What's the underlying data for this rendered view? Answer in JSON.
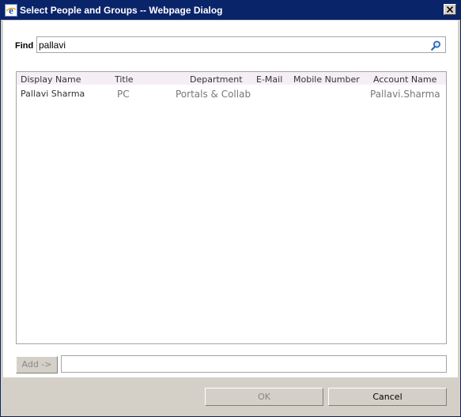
{
  "window": {
    "title": "Select People and Groups -- Webpage Dialog"
  },
  "find": {
    "label": "Find",
    "value": "pallavi"
  },
  "results": {
    "columns": [
      "Display Name",
      "Title",
      "Department",
      "E-Mail",
      "Mobile Number",
      "Account Name"
    ],
    "rows": [
      {
        "display_name": "Pallavi Sharma",
        "title": "PC",
        "department": "Portals & Collab",
        "email": "",
        "mobile": "",
        "account": "Pallavi.Sharma"
      }
    ]
  },
  "add": {
    "label": "Add ->",
    "value": ""
  },
  "footer": {
    "ok_label": "OK",
    "cancel_label": "Cancel"
  },
  "colors": {
    "titlebar": "#0a246a",
    "window": "#d4d0c8",
    "header_row": "#f5eff5"
  }
}
